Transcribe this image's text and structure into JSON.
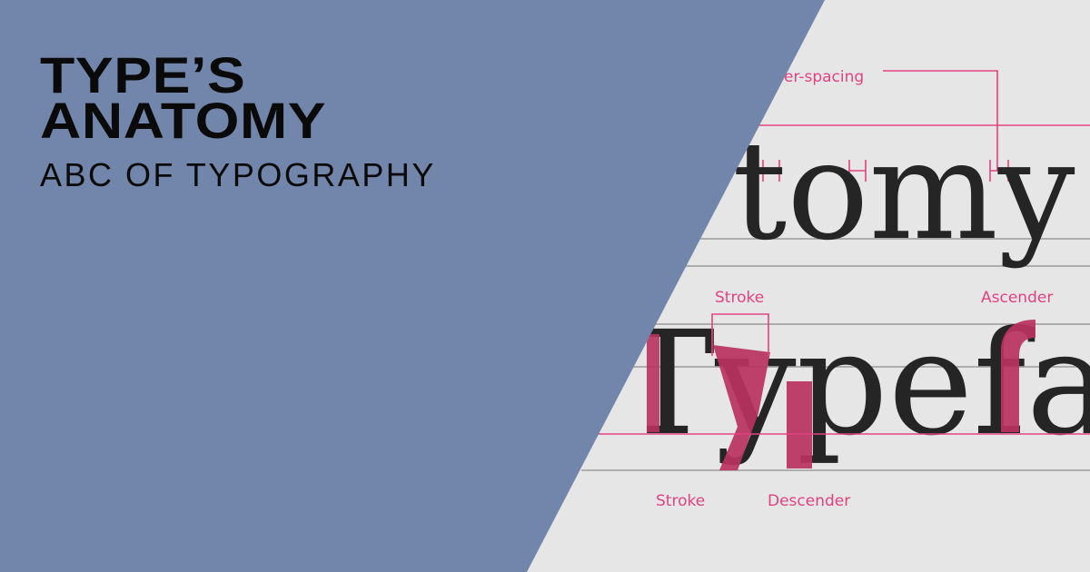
{
  "headline": {
    "line1": "TYPE’S",
    "line2": "ANATOMY",
    "subtitle": "ABC OF TYPOGRAPHY"
  },
  "illustration": {
    "word_top": "tomy",
    "word_bottom": "Typefa",
    "labels": {
      "letter_spacing": "er-spacing",
      "stroke_top": "Stroke",
      "ascender": "Ascender",
      "stroke_bottom": "Stroke",
      "descender": "Descender"
    }
  },
  "colors": {
    "panel": "#7285aa",
    "background": "#e6e6e7",
    "accent": "#e2437f",
    "highlight_glyph": "#b8325f",
    "text": "#0a0a0a"
  }
}
